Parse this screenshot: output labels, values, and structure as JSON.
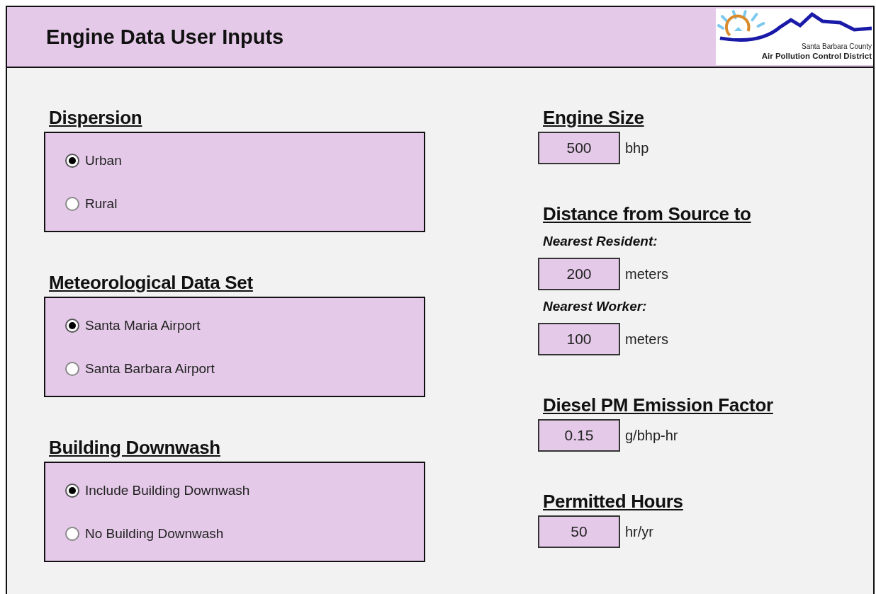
{
  "header": {
    "title": "Engine Data User Inputs",
    "logo": {
      "line_1": "Santa Barbara County",
      "line_2": "Air Pollution Control District"
    }
  },
  "option_groups": [
    {
      "heading": "Dispersion",
      "options": [
        {
          "label": "Urban",
          "selected": true
        },
        {
          "label": "Rural",
          "selected": false
        }
      ]
    },
    {
      "heading": "Meteorological Data Set",
      "options": [
        {
          "label": "Santa Maria Airport",
          "selected": true
        },
        {
          "label": "Santa Barbara Airport",
          "selected": false
        }
      ]
    },
    {
      "heading": "Building Downwash",
      "options": [
        {
          "label": "Include Building Downwash",
          "selected": true
        },
        {
          "label": "No Building Downwash",
          "selected": false
        }
      ]
    }
  ],
  "inputs": [
    {
      "kind": "heading",
      "text": "Engine Size"
    },
    {
      "kind": "field",
      "value": "500",
      "unit": "bhp"
    },
    {
      "kind": "heading",
      "text": "Distance from Source to"
    },
    {
      "kind": "subheading",
      "text": "Nearest Resident:"
    },
    {
      "kind": "field",
      "value": "200",
      "unit": "meters"
    },
    {
      "kind": "subheading",
      "text": "Nearest Worker:"
    },
    {
      "kind": "field",
      "value": "100",
      "unit": "meters"
    },
    {
      "kind": "heading",
      "text": "Diesel PM Emission Factor"
    },
    {
      "kind": "field",
      "value": "0.15",
      "unit": "g/bhp-hr"
    },
    {
      "kind": "heading",
      "text": "Permitted Hours"
    },
    {
      "kind": "field",
      "value": "50",
      "unit": "hr/yr"
    }
  ]
}
